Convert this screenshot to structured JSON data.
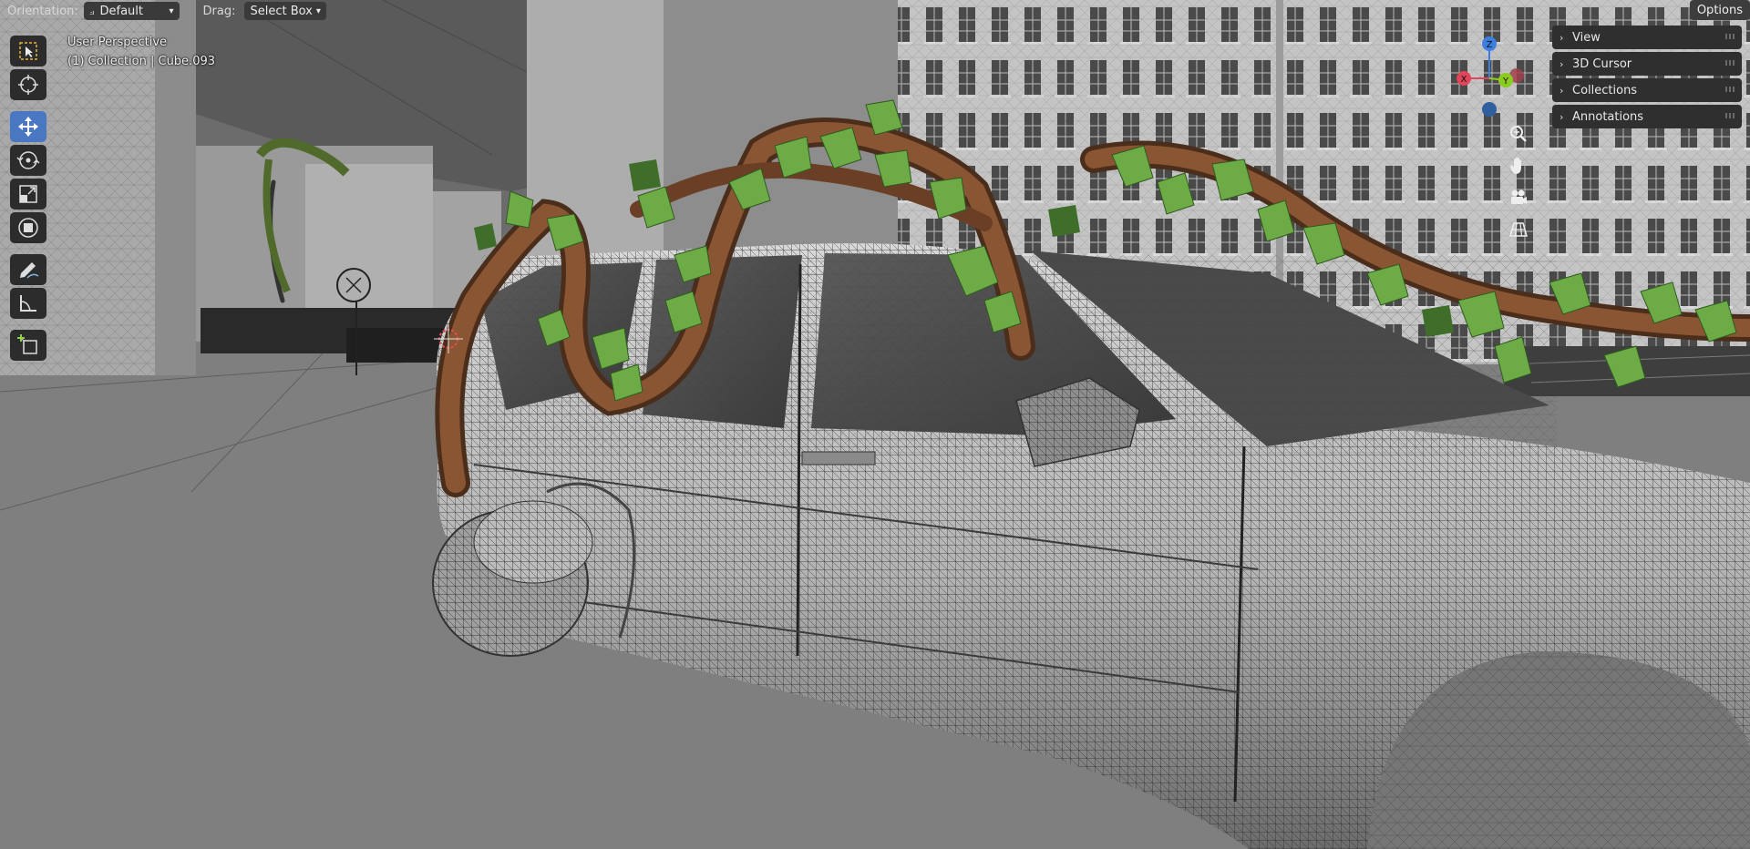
{
  "header": {
    "orientation_label": "Orientation:",
    "orientation_value": "Default",
    "drag_label": "Drag:",
    "drag_value": "Select Box",
    "options_label": "Options"
  },
  "viewport_info": {
    "perspective": "User Perspective",
    "collection": "(1) Collection | Cube.093"
  },
  "toolbar": {
    "tools": [
      "select-box",
      "cursor",
      "move",
      "rotate",
      "scale",
      "transform",
      "annotate",
      "measure",
      "add-cube"
    ],
    "active_tool": "move"
  },
  "gizmo": {
    "axis_x": "X",
    "axis_y": "Y",
    "axis_z": "Z",
    "colors": {
      "x": "#e0455a",
      "y": "#8ccc21",
      "z": "#3c7fe0"
    }
  },
  "nav_buttons": [
    "zoom-icon",
    "pan-hand-icon",
    "camera-icon",
    "grid-icon"
  ],
  "npanel": {
    "items": [
      {
        "label": "View"
      },
      {
        "label": "3D Cursor"
      },
      {
        "label": "Collections"
      },
      {
        "label": "Annotations"
      }
    ]
  },
  "colors": {
    "accent": "#4a77c2",
    "ivy_leaf": "#6cab46",
    "vine_bark": "#7a4a2c"
  }
}
